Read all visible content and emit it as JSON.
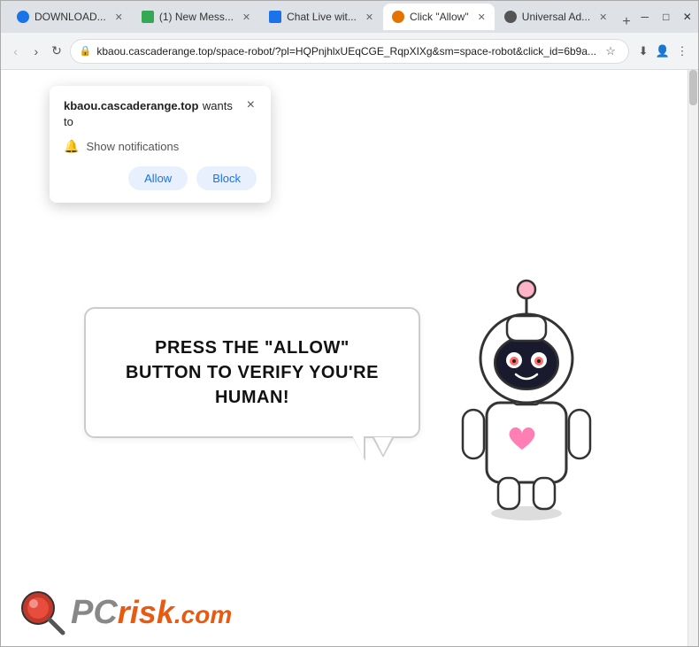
{
  "browser": {
    "tabs": [
      {
        "id": "tab-downloading",
        "label": "DOWNLOAD...",
        "favicon_color": "#1a73e8",
        "active": false,
        "closable": true
      },
      {
        "id": "tab-mail",
        "label": "(1) New Mess...",
        "favicon_color": "#34a853",
        "active": false,
        "closable": true
      },
      {
        "id": "tab-chat",
        "label": "Chat Live wit...",
        "favicon_color": "#1a73e8",
        "active": false,
        "closable": true
      },
      {
        "id": "tab-allow",
        "label": "Click \"Allow\"",
        "favicon_color": "#e37400",
        "active": true,
        "closable": true
      },
      {
        "id": "tab-universal",
        "label": "Universal Ad...",
        "favicon_color": "#555",
        "active": false,
        "closable": true
      }
    ],
    "new_tab_label": "+",
    "address": "kbaou.cascaderange.top/space-robot/?pl=HQPnjhlxUEqCGE_RqpXIXg&sm=space-robot&click_id=6b9a...",
    "window_controls": {
      "minimize": "─",
      "maximize": "□",
      "close": "✕"
    }
  },
  "notification_popup": {
    "site": "kbaou.cascaderange.top",
    "wants_text": "wants",
    "to_text": "to",
    "close_label": "×",
    "notification_label": "Show notifications",
    "allow_label": "Allow",
    "block_label": "Block"
  },
  "page": {
    "bubble_text": "PRESS THE \"ALLOW\" BUTTON TO VERIFY YOU'RE HUMAN!",
    "logo_pc": "PC",
    "logo_risk": "risk",
    "logo_com": ".com"
  },
  "icons": {
    "back": "‹",
    "forward": "›",
    "reload": "↻",
    "star": "☆",
    "download": "⬇",
    "account": "👤",
    "menu": "⋮",
    "bell": "🔔",
    "lock": "🔒"
  }
}
